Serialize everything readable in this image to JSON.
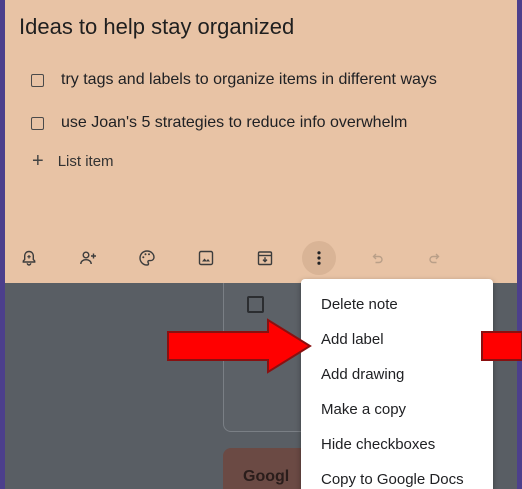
{
  "note": {
    "title": "Ideas to help stay organized",
    "items": [
      {
        "label": "try tags and labels to organize items in different ways",
        "checked": false
      },
      {
        "label": "use Joan's 5 strategies to reduce info overwhelm",
        "checked": false
      }
    ],
    "add_item_label": "List item"
  },
  "toolbar": {
    "buttons": [
      "reminder-icon",
      "collaborator-icon",
      "palette-icon",
      "image-icon",
      "archive-icon",
      "more-icon",
      "undo-icon",
      "redo-icon"
    ]
  },
  "menu": {
    "items": [
      "Delete note",
      "Add label",
      "Add drawing",
      "Make a copy",
      "Hide checkboxes",
      "Copy to Google Docs"
    ]
  },
  "background_note": {
    "title_fragment": "Googl"
  },
  "colors": {
    "note_bg": "#e8c3a5",
    "frame_border": "#4c3f8c",
    "arrow": "#ff0000",
    "menu_bg": "#ffffff"
  }
}
